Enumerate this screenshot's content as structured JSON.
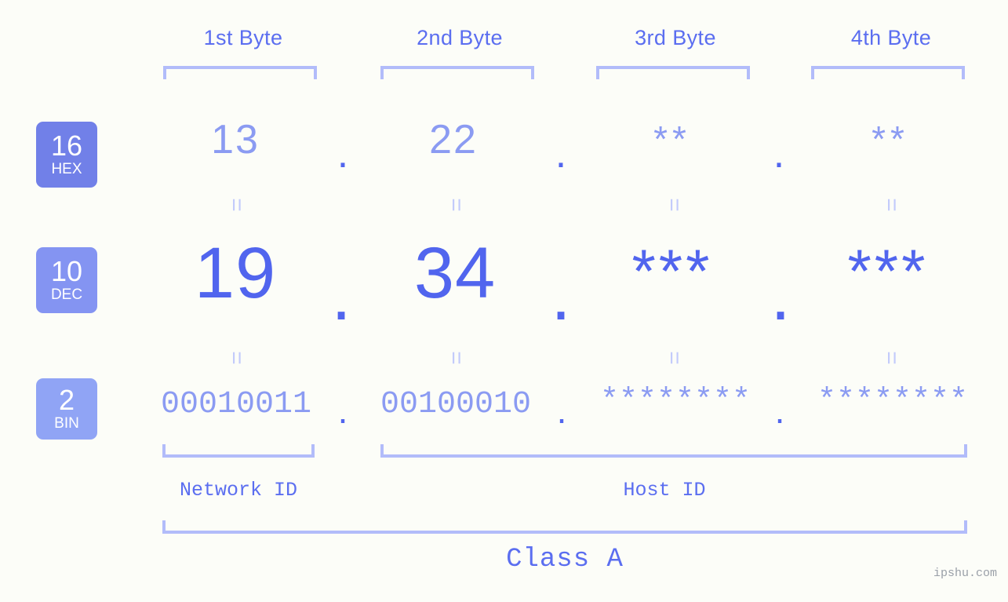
{
  "background_color": "#fcfdf8",
  "accent_color": "#5165ee",
  "accent_light": "#8b9bf2",
  "bracket_color": "#b2bcfa",
  "header": {
    "byte_labels": [
      "1st Byte",
      "2nd Byte",
      "3rd Byte",
      "4th Byte"
    ]
  },
  "bases": [
    {
      "number": "16",
      "name": "HEX",
      "color": "#7180e8"
    },
    {
      "number": "10",
      "name": "DEC",
      "color": "#8494f2"
    },
    {
      "number": "2",
      "name": "BIN",
      "color": "#90a4f5"
    }
  ],
  "rows": {
    "hex": {
      "base_number": "16",
      "base_name": "HEX",
      "values": [
        "13",
        "22",
        "**",
        "**"
      ],
      "separator": "."
    },
    "dec": {
      "base_number": "10",
      "base_name": "DEC",
      "values": [
        "19",
        "34",
        "***",
        "***"
      ],
      "separator": "."
    },
    "bin": {
      "base_number": "2",
      "base_name": "BIN",
      "values": [
        "00010011",
        "00100010",
        "********",
        "********"
      ],
      "separator": "."
    }
  },
  "connectors": {
    "equals_symbol": "="
  },
  "segments": {
    "network_id": "Network ID",
    "host_id": "Host ID"
  },
  "class_label": "Class A",
  "watermark": "ipshu.com"
}
